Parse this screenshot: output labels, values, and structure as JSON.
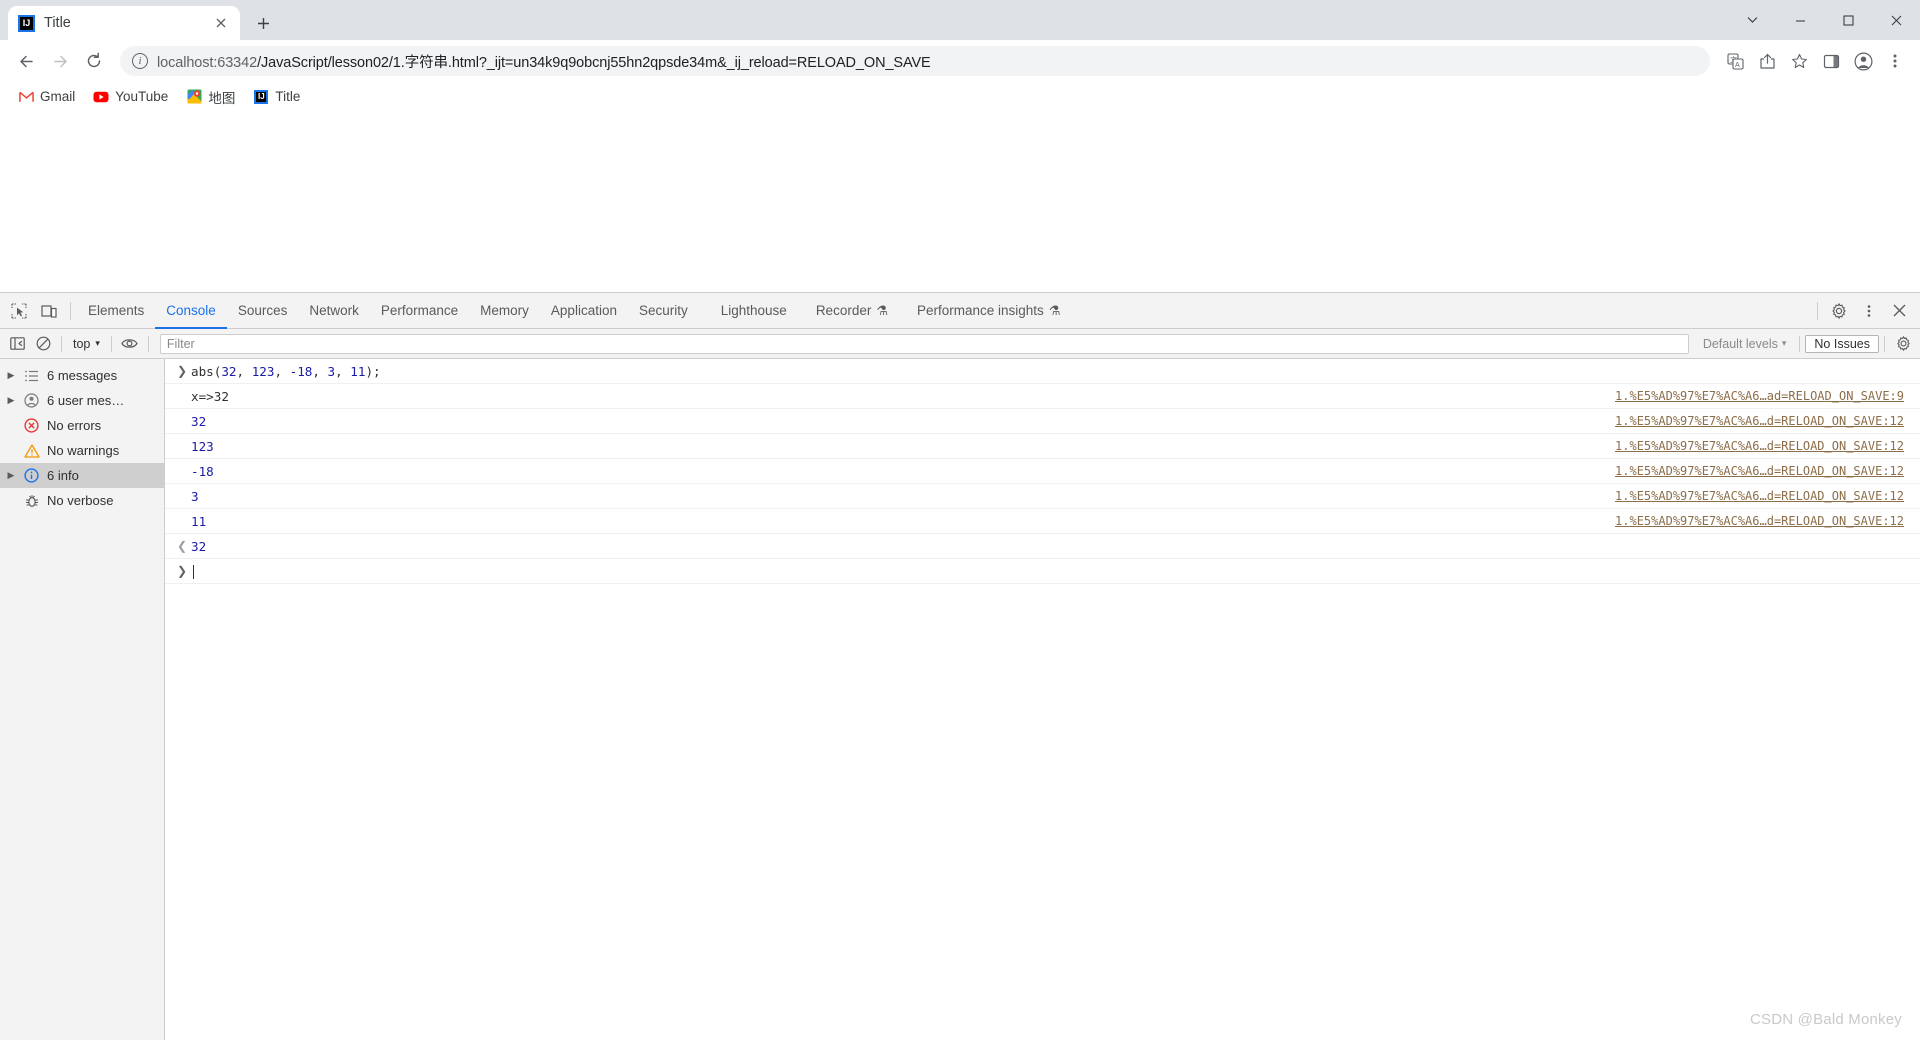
{
  "browser": {
    "tab": {
      "title": "Title",
      "favicon": "intellij-idea-icon",
      "close_icon": "close-icon"
    },
    "new_tab_label": "+",
    "window_controls": {
      "dropdown_icon": "chevron-down-icon",
      "minimize_icon": "minimize-icon",
      "maximize_icon": "maximize-icon",
      "close_icon": "window-close-icon"
    },
    "nav": {
      "back_icon": "back-arrow-icon",
      "forward_icon": "forward-arrow-icon",
      "reload_icon": "reload-icon"
    },
    "omnibox": {
      "info_icon": "page-info-icon",
      "url_prefix": "localhost:63342",
      "url_rest": "/JavaScript/lesson02/1.字符串.html?_ijt=un34k9q9obcnj55hn2qpsde34m&_ij_reload=RELOAD_ON_SAVE"
    },
    "toolbar_icons": [
      {
        "name": "translate-icon"
      },
      {
        "name": "share-icon"
      },
      {
        "name": "bookmark-star-icon"
      },
      {
        "name": "side-panel-icon"
      },
      {
        "name": "profile-avatar-icon"
      },
      {
        "name": "more-menu-icon"
      }
    ],
    "bookmarks": [
      {
        "label": "Gmail",
        "icon": "gmail-icon"
      },
      {
        "label": "YouTube",
        "icon": "youtube-icon"
      },
      {
        "label": "地图",
        "icon": "google-maps-icon"
      },
      {
        "label": "Title",
        "icon": "intellij-idea-icon"
      }
    ]
  },
  "devtools": {
    "left_icons": [
      {
        "name": "inspect-element-icon"
      },
      {
        "name": "device-toolbar-icon"
      }
    ],
    "tabs": [
      {
        "label": "Elements",
        "active": false,
        "flask": false
      },
      {
        "label": "Console",
        "active": true,
        "flask": false
      },
      {
        "label": "Sources",
        "active": false,
        "flask": false
      },
      {
        "label": "Network",
        "active": false,
        "flask": false
      },
      {
        "label": "Performance",
        "active": false,
        "flask": false
      },
      {
        "label": "Memory",
        "active": false,
        "flask": false
      },
      {
        "label": "Application",
        "active": false,
        "flask": false
      },
      {
        "label": "Security",
        "active": false,
        "flask": false
      },
      {
        "label": "Lighthouse",
        "active": false,
        "flask": false
      },
      {
        "label": "Recorder",
        "active": false,
        "flask": true
      },
      {
        "label": "Performance insights",
        "active": false,
        "flask": true
      }
    ],
    "right_icons": [
      {
        "name": "settings-gear-icon"
      },
      {
        "name": "more-options-icon"
      },
      {
        "name": "close-devtools-icon"
      }
    ],
    "console_toolbar": {
      "sidebar_toggle_icon": "console-sidebar-toggle-icon",
      "clear_icon": "clear-console-icon",
      "context": "top",
      "context_caret": "▾",
      "eye_icon": "live-expression-eye-icon",
      "filter_placeholder": "Filter",
      "levels_label": "Default levels",
      "levels_caret": "▾",
      "issues_label": "No Issues",
      "settings_icon": "console-settings-gear-icon"
    },
    "sidebar": [
      {
        "label": "6 messages",
        "icon": "list-icon",
        "arrow": true,
        "selected": false
      },
      {
        "label": "6 user mes…",
        "icon": "user-icon",
        "arrow": true,
        "selected": false
      },
      {
        "label": "No errors",
        "icon": "error-icon",
        "arrow": false,
        "selected": false
      },
      {
        "label": "No warnings",
        "icon": "warning-icon",
        "arrow": false,
        "selected": false
      },
      {
        "label": "6 info",
        "icon": "info-icon",
        "arrow": true,
        "selected": true
      },
      {
        "label": "No verbose",
        "icon": "verbose-bug-icon",
        "arrow": false,
        "selected": false
      }
    ],
    "console_rows": [
      {
        "kind": "input",
        "gutter": "❯",
        "segments": [
          {
            "t": "abs(",
            "c": "plain"
          },
          {
            "t": "32",
            "c": "num"
          },
          {
            "t": ", ",
            "c": "plain"
          },
          {
            "t": "123",
            "c": "num"
          },
          {
            "t": ", ",
            "c": "plain"
          },
          {
            "t": "-18",
            "c": "num"
          },
          {
            "t": ", ",
            "c": "plain"
          },
          {
            "t": "3",
            "c": "num"
          },
          {
            "t": ", ",
            "c": "plain"
          },
          {
            "t": "11",
            "c": "num"
          },
          {
            "t": ");",
            "c": "plain"
          }
        ],
        "source": ""
      },
      {
        "kind": "log",
        "gutter": "",
        "segments": [
          {
            "t": "x=>32",
            "c": "plain"
          }
        ],
        "source": "1.%E5%AD%97%E7%AC%A6…ad=RELOAD_ON_SAVE:9"
      },
      {
        "kind": "log",
        "gutter": "",
        "segments": [
          {
            "t": "32",
            "c": "num"
          }
        ],
        "source": "1.%E5%AD%97%E7%AC%A6…d=RELOAD_ON_SAVE:12"
      },
      {
        "kind": "log",
        "gutter": "",
        "segments": [
          {
            "t": "123",
            "c": "num"
          }
        ],
        "source": "1.%E5%AD%97%E7%AC%A6…d=RELOAD_ON_SAVE:12"
      },
      {
        "kind": "log",
        "gutter": "",
        "segments": [
          {
            "t": "-18",
            "c": "num"
          }
        ],
        "source": "1.%E5%AD%97%E7%AC%A6…d=RELOAD_ON_SAVE:12"
      },
      {
        "kind": "log",
        "gutter": "",
        "segments": [
          {
            "t": "3",
            "c": "num"
          }
        ],
        "source": "1.%E5%AD%97%E7%AC%A6…d=RELOAD_ON_SAVE:12"
      },
      {
        "kind": "log",
        "gutter": "",
        "segments": [
          {
            "t": "11",
            "c": "num"
          }
        ],
        "source": "1.%E5%AD%97%E7%AC%A6…d=RELOAD_ON_SAVE:12"
      },
      {
        "kind": "output",
        "gutter": "❮",
        "segments": [
          {
            "t": "32",
            "c": "num"
          }
        ],
        "source": ""
      },
      {
        "kind": "prompt",
        "gutter": "❯",
        "segments": [],
        "source": ""
      }
    ]
  },
  "watermark": "CSDN @Bald Monkey",
  "colors": {
    "accent": "#1a73e8",
    "tabstrip_bg": "#dee1e6",
    "devtools_bg": "#f3f3f3",
    "number_blue": "#1a1aa6",
    "source_link": "#8c6e4b"
  }
}
